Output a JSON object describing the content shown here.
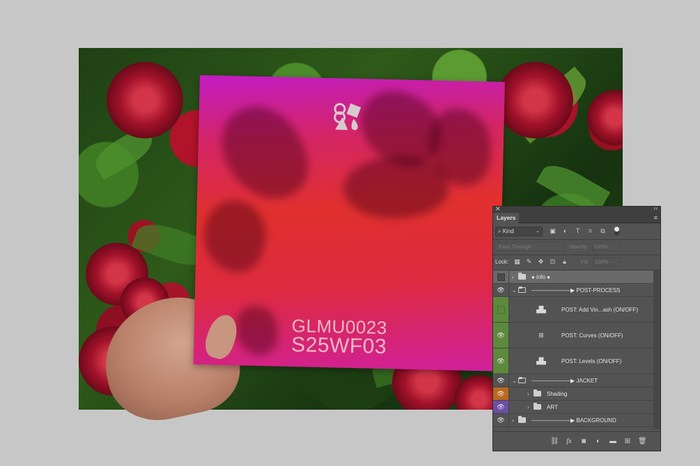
{
  "jacket": {
    "code_line1": "GLMU0023",
    "code_line2": "S25WF03"
  },
  "layers_panel": {
    "tab_label": "Layers",
    "filter": {
      "kind_label": "Kind"
    },
    "blend_mode": "Pass Through",
    "opacity_label": "Opacity:",
    "opacity_value": "100%",
    "lock_label": "Lock:",
    "fill_label": "Fill:",
    "fill_value": "100%",
    "layers": [
      {
        "name": "● info ●",
        "type": "group",
        "visible": false,
        "color": "",
        "expanded": false
      },
      {
        "name": "———————▶ POST-PROCESS",
        "type": "group",
        "visible": true,
        "color": "",
        "expanded": true
      },
      {
        "name": "POST: Add Vin...ash (ON/OFF)",
        "type": "adjustment",
        "icon": "levels-icon",
        "visible": false,
        "color": "#5c8a3c"
      },
      {
        "name": "POST: Curves (ON/OFF)",
        "type": "adjustment",
        "icon": "curves-icon",
        "visible": true,
        "color": "#5c8a3c"
      },
      {
        "name": "POST: Levels (ON/OFF)",
        "type": "adjustment",
        "icon": "levels-icon",
        "visible": true,
        "color": "#5c8a3c"
      },
      {
        "name": "———————▶ JACKET",
        "type": "group",
        "visible": true,
        "color": "",
        "expanded": true
      },
      {
        "name": "Shading",
        "type": "group",
        "visible": true,
        "color": "#b86a1e",
        "expanded": false
      },
      {
        "name": "ART",
        "type": "group",
        "visible": true,
        "color": "#6c4fa3",
        "expanded": false
      },
      {
        "name": "———————▶ BACKGROUND",
        "type": "group",
        "visible": true,
        "color": "",
        "expanded": false
      }
    ]
  }
}
